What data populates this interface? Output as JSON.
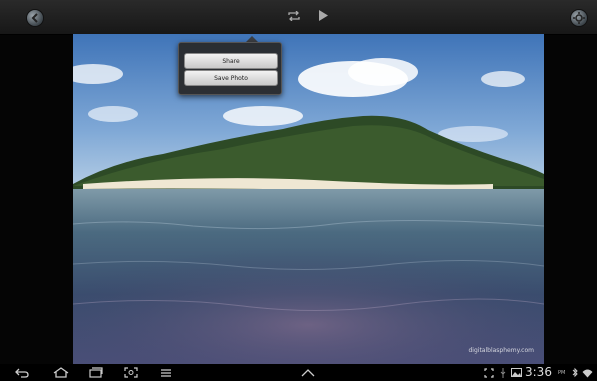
{
  "top_bar": {
    "icons": [
      "back-circle-icon",
      "repeat-icon",
      "play-icon",
      "settings-circle-icon"
    ]
  },
  "photo": {
    "description_icon": "island-photo",
    "watermark": "digitalblasphemy.com"
  },
  "popup_menu": {
    "items": [
      {
        "label": "Share"
      },
      {
        "label": "Save Photo"
      }
    ]
  },
  "status_bar": {
    "time": "3:36",
    "ampm": "PM",
    "nav_icons": [
      "back-icon",
      "home-icon",
      "recent-apps-icon",
      "screenshot-icon",
      "menu-icon",
      "chevron-up-icon"
    ],
    "status_icons": [
      "expand-icon",
      "usb-icon",
      "gallery-icon",
      "bluetooth-icon",
      "wifi-icon"
    ]
  },
  "colors": {
    "bar_bg": "#000000",
    "topbar_bg": "#222222",
    "menu_button_bg": "#e6e6e6"
  }
}
